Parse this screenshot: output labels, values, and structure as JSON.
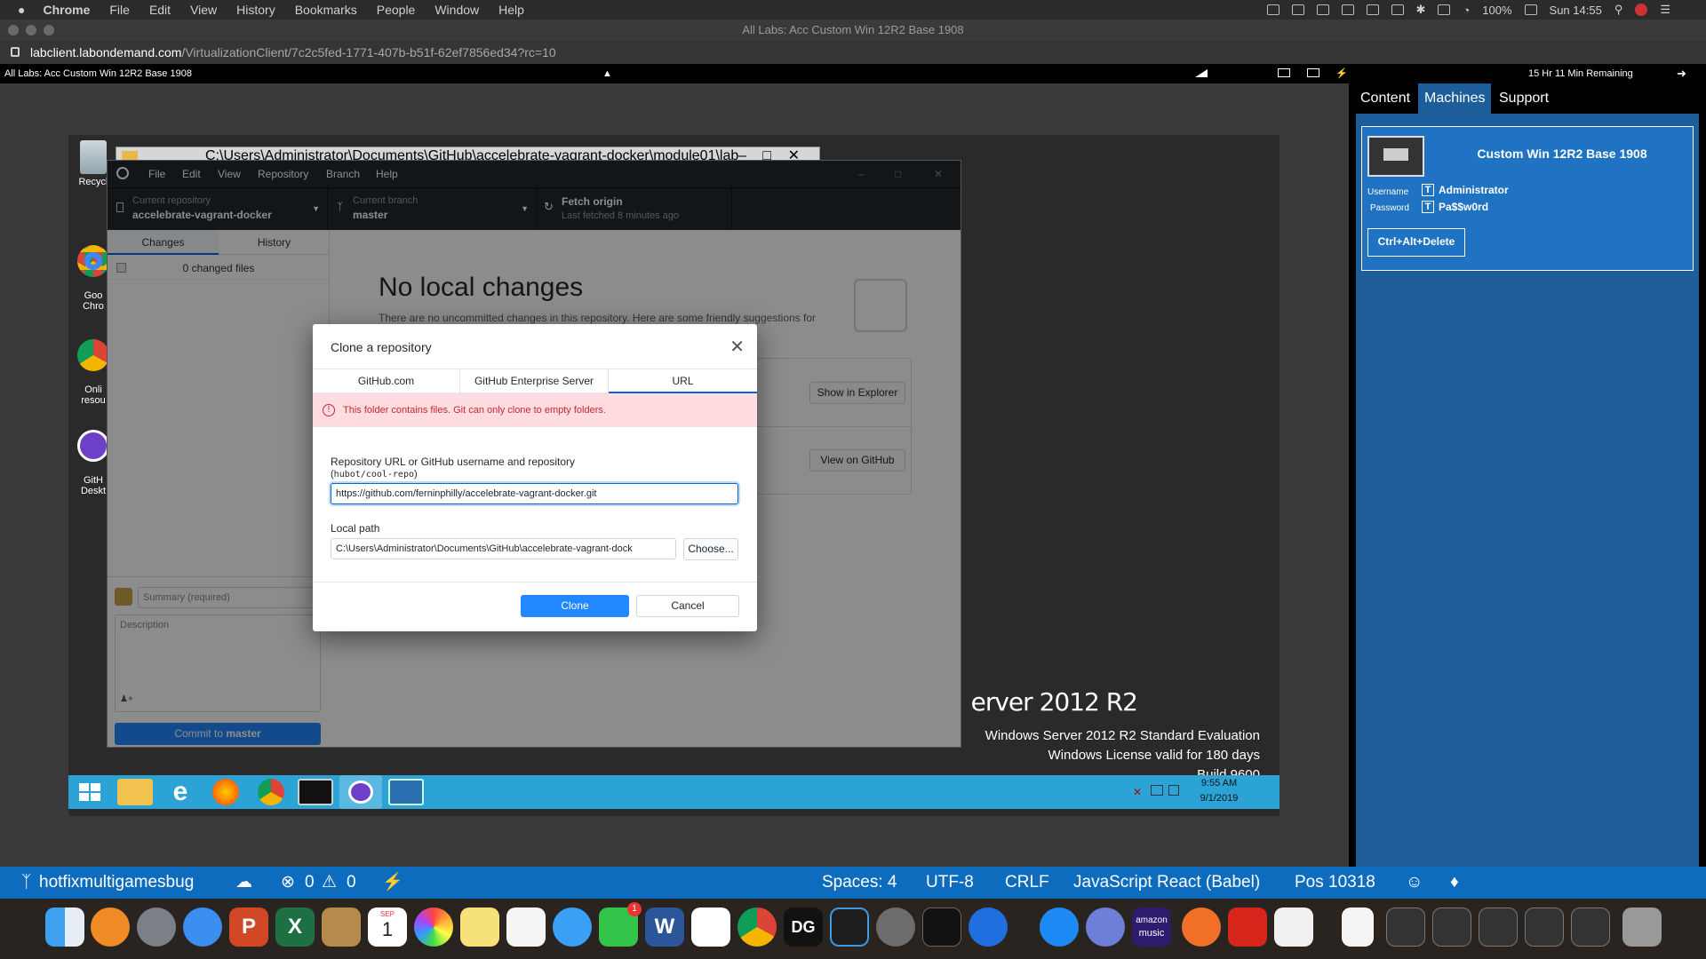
{
  "mac_menubar": {
    "app": "Chrome",
    "menus": [
      "File",
      "Edit",
      "View",
      "History",
      "Bookmarks",
      "People",
      "Window",
      "Help"
    ],
    "battery": "100%",
    "clock": "Sun 14:55"
  },
  "chrome": {
    "window_title": "All Labs: Acc Custom Win 12R2 Base 1908",
    "url_host": "labclient.labondemand.com",
    "url_path": "/VirtualizationClient/7c2c5fed-1771-407b-b51f-62ef7856ed34?rc=10"
  },
  "lab_toolbar": {
    "title": "All Labs: Acc Custom Win 12R2 Base 1908",
    "time_remaining": "15 Hr 11 Min Remaining"
  },
  "side_panel": {
    "tabs": [
      "Content",
      "Machines",
      "Support"
    ],
    "selected_tab": "Machines",
    "machine_name": "Custom Win 12R2 Base 1908",
    "username_label": "Username",
    "username": "Administrator",
    "password_label": "Password",
    "password": "Pa$$w0rd",
    "type_marker": "T",
    "ctrl_alt_del": "Ctrl+Alt+Delete"
  },
  "vm_desktop": {
    "icons": [
      "Recycl",
      "Goo\nChro",
      "Onli\nresou",
      "GitH\nDeskt"
    ],
    "explorer_path": "C:\\Users\\Administrator\\Documents\\GitHub\\accelebrate-vagrant-docker\\module01\\lab",
    "server_brand": "erver 2012 R2",
    "edition": "Windows Server 2012 R2 Standard Evaluation",
    "license": "Windows License valid for 180 days",
    "build": "Build 9600",
    "taskbar_time": "9:55 AM",
    "taskbar_date": "9/1/2019"
  },
  "github_desktop": {
    "menus": [
      "File",
      "Edit",
      "View",
      "Repository",
      "Branch",
      "Help"
    ],
    "repo_label": "Current repository",
    "repo_name": "accelebrate-vagrant-docker",
    "branch_label": "Current branch",
    "branch_name": "master",
    "fetch_label": "Fetch origin",
    "fetch_sub": "Last fetched 8 minutes ago",
    "tab_changes": "Changes",
    "tab_history": "History",
    "changed_files": "0 changed files",
    "no_changes": "No local changes",
    "suggestion": "There are no uncommitted changes in this repository. Here are some friendly suggestions for",
    "show_in_explorer": "Show in Explorer",
    "view_on_github": "View on GitHub",
    "summary_placeholder": "Summary (required)",
    "description_placeholder": "Description",
    "commit_button_prefix": "Commit to ",
    "commit_button_branch": "master"
  },
  "clone_dialog": {
    "title": "Clone a repository",
    "tabs": [
      "GitHub.com",
      "GitHub Enterprise Server",
      "URL"
    ],
    "selected_tab": "URL",
    "error": "This folder contains files. Git can only clone to empty folders.",
    "url_label": "Repository URL or GitHub username and repository",
    "url_hint_open": "(",
    "url_hint_code": "hubot/cool-repo",
    "url_hint_close": ")",
    "url_value": "https://github.com/ferninphilly/accelebrate-vagrant-docker.git",
    "local_path_label": "Local path",
    "local_path_value": "C:\\Users\\Administrator\\Documents\\GitHub\\accelebrate-vagrant-dock",
    "choose_button": "Choose...",
    "clone_button": "Clone",
    "cancel_button": "Cancel"
  },
  "vscode_status": {
    "branch": "hotfixmultigamesbug",
    "errors": "0",
    "warnings": "0",
    "spaces": "Spaces: 4",
    "encoding": "UTF-8",
    "eol": "CRLF",
    "language": "JavaScript React (Babel)",
    "position": "Pos 10318"
  },
  "dock": {
    "calendar_month": "SEP",
    "calendar_day": "1",
    "facetime_badge": "1",
    "amazon_music_top": "amazon",
    "amazon_music_bottom": "music",
    "dg_label": "DG",
    "word_label": "W",
    "powerpoint_label": "P",
    "excel_label": "X"
  },
  "colors": {
    "status_bar": "#0e6cbf",
    "panel_blue": "#1d5e9a",
    "taskbar": "#2ca3d7",
    "clone_button": "#2188ff",
    "error_bg": "#ffdce0",
    "error_text": "#cb2431"
  }
}
